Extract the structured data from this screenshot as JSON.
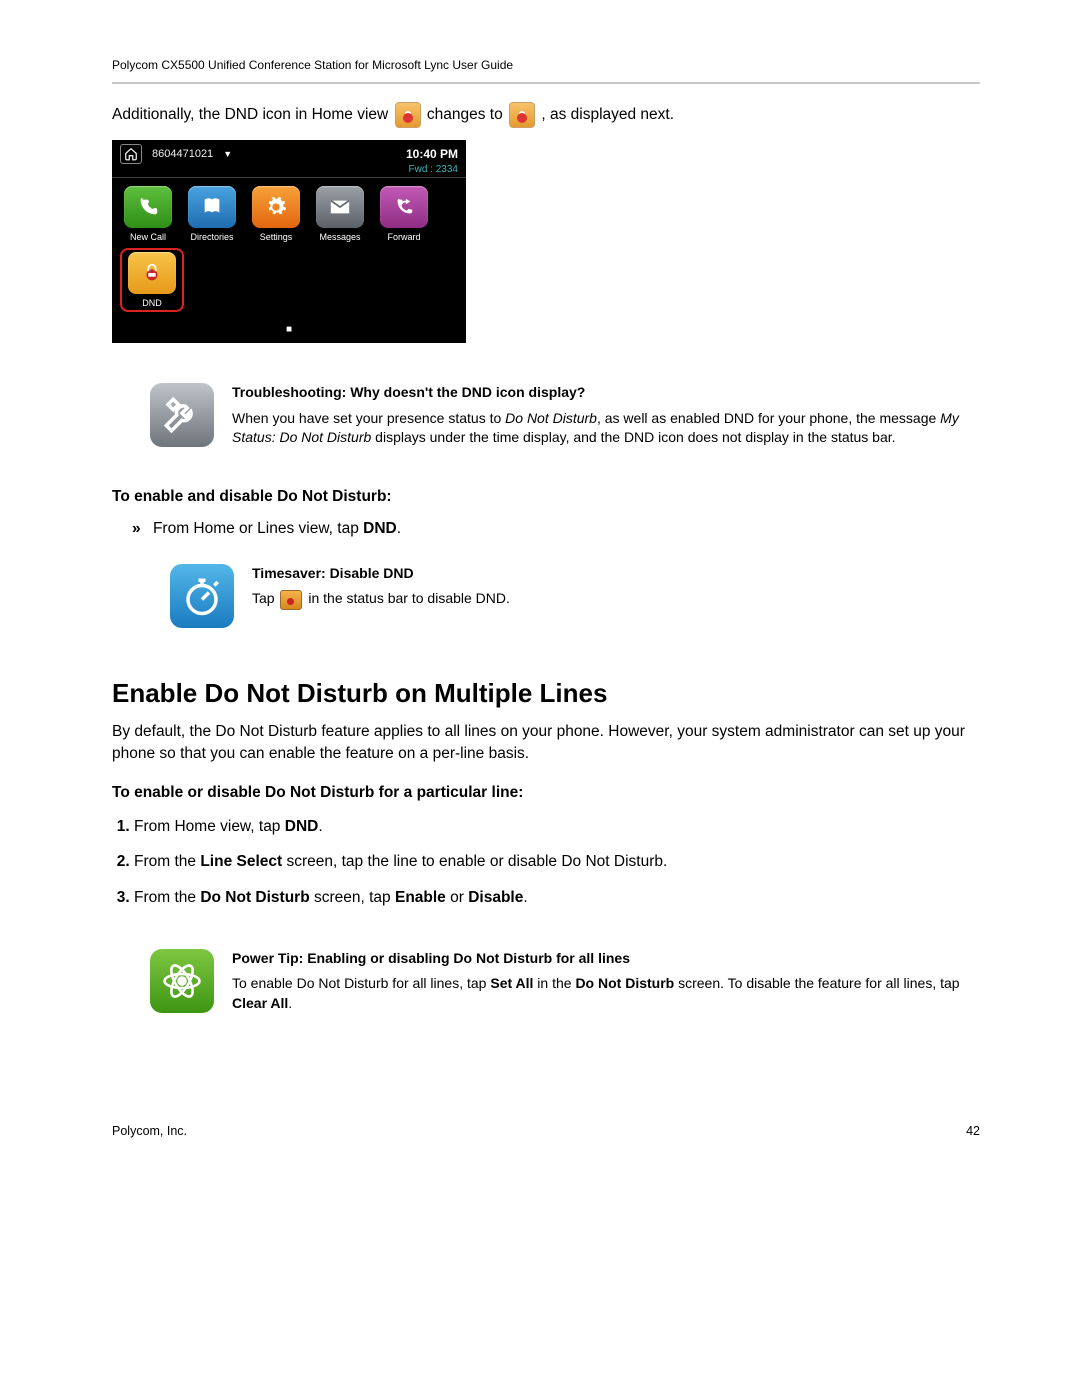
{
  "header_text": "Polycom CX5500 Unified Conference Station for Microsoft Lync User Guide",
  "intro": {
    "part1": "Additionally, the DND icon in Home view ",
    "part2": " changes to ",
    "part3": ", as displayed next."
  },
  "phone": {
    "extension": "8604471021",
    "time": "10:40 PM",
    "fwd": "Fwd : 2334",
    "tiles": {
      "new_call": "New Call",
      "directories": "Directories",
      "settings": "Settings",
      "messages": "Messages",
      "forward": "Forward",
      "dnd": "DND"
    }
  },
  "trouble": {
    "title": "Troubleshooting: Why doesn't the DND icon display?",
    "l1": "When you have set your presence status to ",
    "l1_i": "Do Not Disturb",
    "l1_b": ", as well as enabled DND for your phone, the message ",
    "l2_i": "My Status: Do Not Disturb",
    "l2_b": " displays under the time display, and the DND icon does not display in the status bar."
  },
  "enable_heading": "To enable and disable Do Not Disturb:",
  "enable_line_pre": "From Home or Lines view, tap ",
  "enable_line_bold": "DND",
  "enable_line_post": ".",
  "timesaver": {
    "title": "Timesaver: Disable DND",
    "pre": "Tap ",
    "post": " in the status bar to disable DND."
  },
  "section_heading": "Enable Do Not Disturb on Multiple Lines",
  "section_para": "By default, the Do Not Disturb feature applies to all lines on your phone. However, your system administrator can set up your phone so that you can enable the feature on a per-line basis.",
  "steps_heading": "To enable or disable Do Not Disturb for a particular line:",
  "steps": {
    "s1_pre": "From Home view, tap ",
    "s1_b": "DND",
    "s1_post": ".",
    "s2_pre": "From the ",
    "s2_b": "Line Select",
    "s2_post": " screen, tap the line to enable or disable Do Not Disturb.",
    "s3_pre": "From the ",
    "s3_b1": "Do Not Disturb",
    "s3_mid": " screen, tap ",
    "s3_b2": "Enable",
    "s3_or": " or ",
    "s3_b3": "Disable",
    "s3_post": "."
  },
  "powertip": {
    "title": "Power Tip: Enabling or disabling Do Not Disturb for all lines",
    "pre": "To enable Do Not Disturb for all lines, tap ",
    "b1": "Set All",
    "mid": " in the ",
    "b2": "Do Not Disturb",
    "mid2": " screen. To disable the feature for all lines, tap ",
    "b3": "Clear All",
    "post": "."
  },
  "footer": {
    "company": "Polycom, Inc.",
    "page": "42"
  }
}
